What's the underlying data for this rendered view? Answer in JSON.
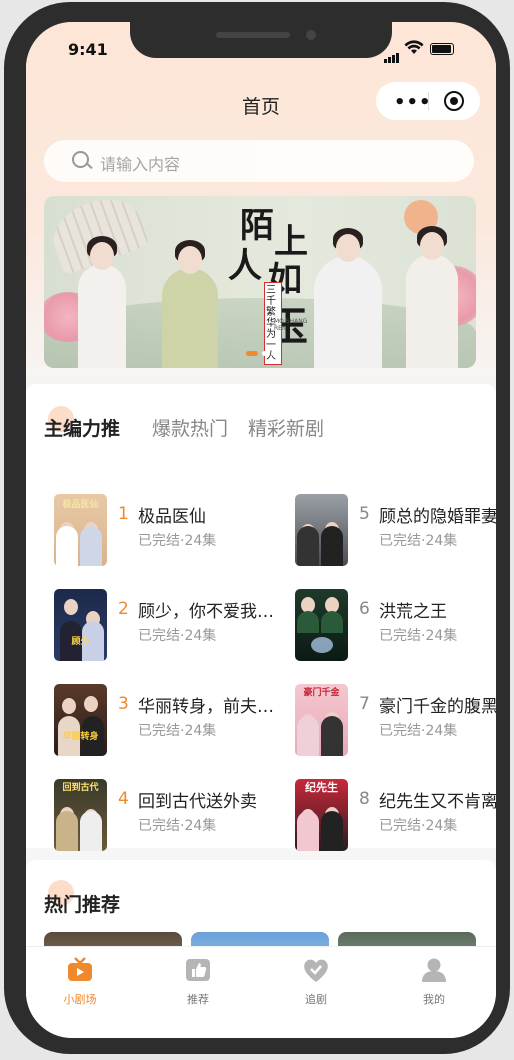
{
  "status": {
    "time": "9:41"
  },
  "nav": {
    "title": "首页"
  },
  "search": {
    "placeholder": "请输入内容"
  },
  "banner": {
    "title_chars": [
      "陌",
      "上",
      "人",
      "如",
      "玉"
    ],
    "subtitle": "三千繁华为一人",
    "small_text": "MO SHANG REN"
  },
  "tabs": [
    {
      "label": "主编力推",
      "active": true
    },
    {
      "label": "爆款热门",
      "active": false
    },
    {
      "label": "精彩新剧",
      "active": false
    }
  ],
  "dramas": [
    {
      "rank": "1",
      "title": "极品医仙",
      "meta": "已完结·24集"
    },
    {
      "rank": "2",
      "title": "顾少，你不爱我…",
      "meta": "已完结·24集"
    },
    {
      "rank": "3",
      "title": "华丽转身，前夫…",
      "meta": "已完结·24集"
    },
    {
      "rank": "4",
      "title": "回到古代送外卖",
      "meta": "已完结·24集"
    },
    {
      "rank": "5",
      "title": "顾总的隐婚罪妻",
      "meta": "已完结·24集"
    },
    {
      "rank": "6",
      "title": "洪荒之王",
      "meta": "已完结·24集"
    },
    {
      "rank": "7",
      "title": "豪门千金的腹黑",
      "meta": "已完结·24集"
    },
    {
      "rank": "8",
      "title": "纪先生又不肯离",
      "meta": "已完结·24集"
    }
  ],
  "thumb_captions": [
    "极品医仙",
    "顾少",
    "华丽转身",
    "回到古代",
    "",
    "",
    "豪门千金",
    "纪先生"
  ],
  "section2": {
    "title": "热门推荐"
  },
  "tabbar": [
    {
      "label": "小剧场",
      "icon": "tv-icon",
      "active": true
    },
    {
      "label": "推荐",
      "icon": "thumbs-up-icon",
      "active": false
    },
    {
      "label": "追剧",
      "icon": "heart-icon",
      "active": false
    },
    {
      "label": "我的",
      "icon": "user-icon",
      "active": false
    }
  ],
  "colors": {
    "accent": "#f0892b",
    "header_bg": "#fde6d6"
  }
}
